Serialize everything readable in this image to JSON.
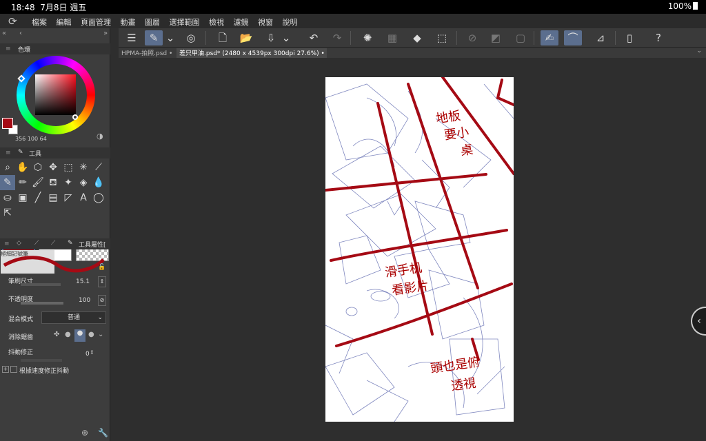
{
  "status": {
    "time": "18:48",
    "date": "7月8日 週五",
    "battery": "100%"
  },
  "menu": [
    "檔案",
    "編輯",
    "頁面管理",
    "動畫",
    "圖層",
    "選擇範圍",
    "檢視",
    "濾鏡",
    "視窗",
    "說明"
  ],
  "tabs": [
    {
      "label": "HPMA-拍照.psd"
    },
    {
      "label": "差只甲油.psd* (2480 x 4539px 300dpi 27.6%)"
    }
  ],
  "color_panel": {
    "title": "色環",
    "readout": "356  100  64",
    "main_color": "#a50a14",
    "sub_color": "#ffffff"
  },
  "tool_panel": {
    "title": "工具"
  },
  "tool_property": {
    "title": "工具屬性[",
    "brush_name": "極細記號筆",
    "brush_size_label": "筆刷尺寸",
    "brush_size_value": "15.1",
    "opacity_label": "不透明度",
    "opacity_value": "100",
    "blend_label": "混合模式",
    "blend_value": "普通",
    "antialias_label": "消除鋸齒",
    "stabilization_label": "抖動修正",
    "stabilization_value": "0",
    "speed_stab_label": "根據速度修正抖動"
  },
  "annotations": [
    {
      "text": "地板"
    },
    {
      "text": "要小"
    },
    {
      "text": "桌"
    },
    {
      "text": "滑手机"
    },
    {
      "text": "看影片"
    },
    {
      "text": "頭也是俯"
    },
    {
      "text": "透視"
    }
  ]
}
